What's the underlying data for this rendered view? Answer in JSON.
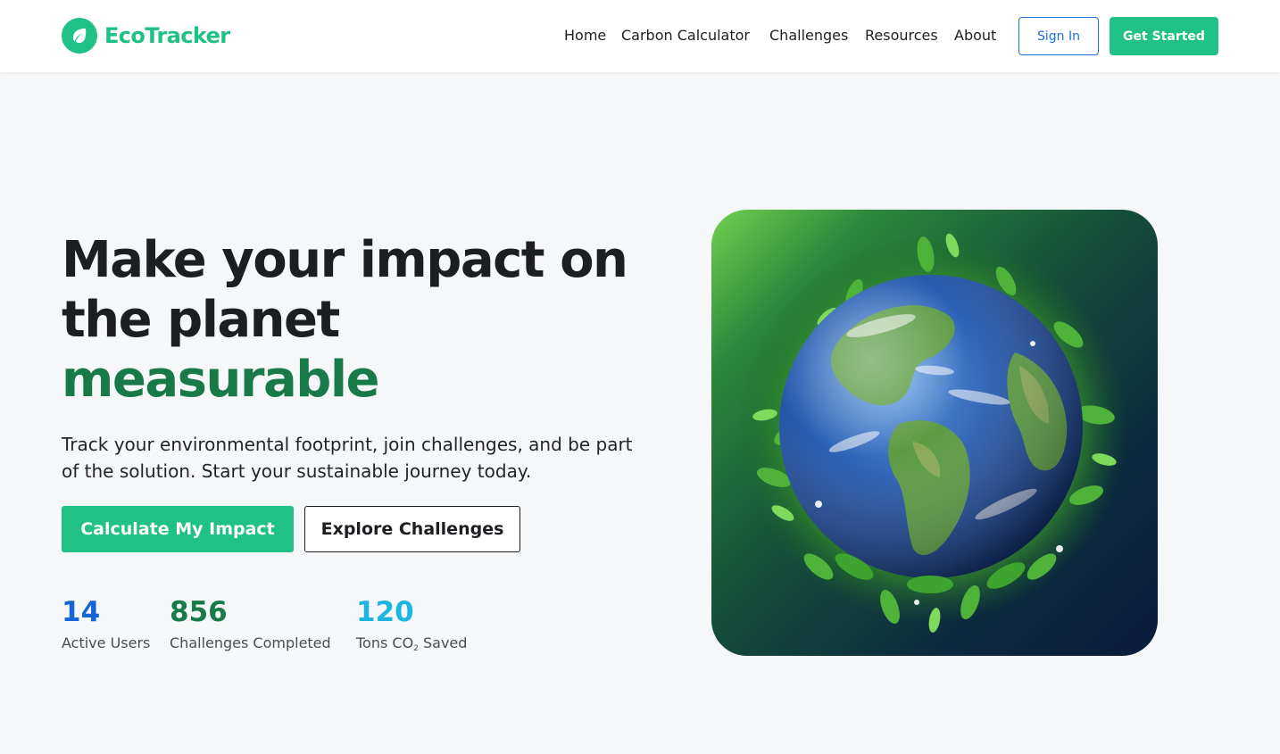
{
  "brand": {
    "name": "EcoTracker",
    "icon": "leaf-icon",
    "color": "#20c186"
  },
  "nav": {
    "items": [
      {
        "label": "Home",
        "name": "nav-home"
      },
      {
        "label": "Carbon Calculator",
        "name": "nav-carbon-calculator"
      },
      {
        "label": "Challenges",
        "name": "nav-challenges"
      },
      {
        "label": "Resources",
        "name": "nav-resources"
      },
      {
        "label": "About",
        "name": "nav-about"
      }
    ],
    "sign_in": "Sign In",
    "get_started": "Get Started"
  },
  "hero": {
    "title_line1": "Make your impact on",
    "title_line2": "the planet",
    "title_accent": "measurable",
    "subtitle": "Track your environmental footprint, join challenges, and be part of the solution. Start your sustainable journey today.",
    "primary_cta": "Calculate My Impact",
    "secondary_cta": "Explore Challenges",
    "image": "earth-with-plants-illustration"
  },
  "stats": [
    {
      "value": "14",
      "label": "Active Users",
      "color": "#1565d8"
    },
    {
      "value": "856",
      "label": "Challenges Completed",
      "color": "#177a48"
    },
    {
      "value": "120",
      "label_pre": "Tons CO",
      "label_sub": "2",
      "label_post": " Saved",
      "color": "#1bb5e0"
    }
  ],
  "colors": {
    "accent": "#20c186",
    "accent_dark": "#177a48",
    "link_blue": "#1e6fd9"
  }
}
